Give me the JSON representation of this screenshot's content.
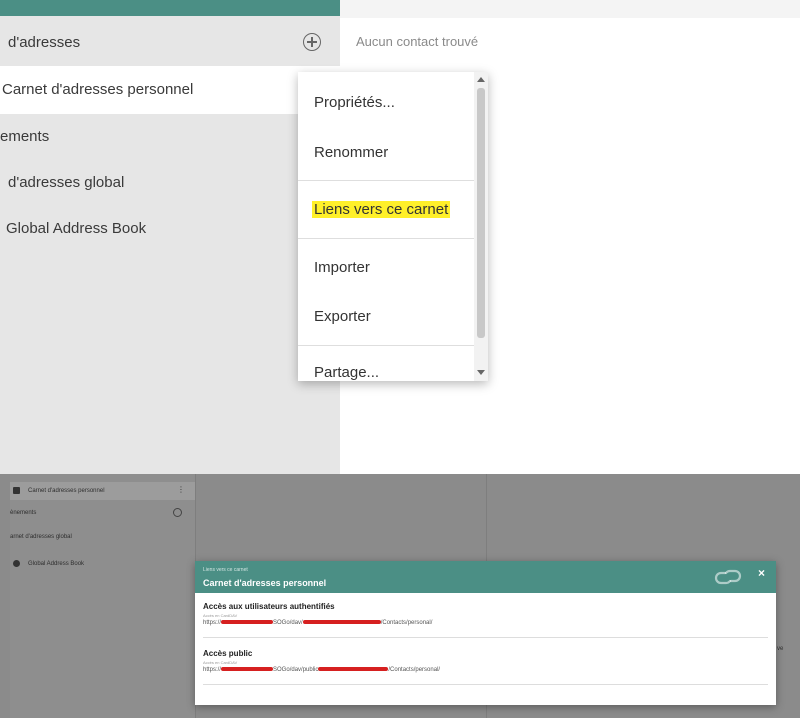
{
  "sidebar": {
    "header_label": "d'adresses",
    "items": [
      {
        "label": "Carnet d'adresses personnel"
      },
      {
        "label": "ements"
      },
      {
        "label": "d'adresses global"
      },
      {
        "label": "Global Address Book"
      }
    ]
  },
  "main": {
    "empty_message": "Aucun contact trouvé"
  },
  "context_menu": {
    "items": [
      {
        "label": "Propriétés..."
      },
      {
        "label": "Renommer"
      },
      {
        "label": "Liens vers ce carnet"
      },
      {
        "label": "Importer"
      },
      {
        "label": "Exporter"
      },
      {
        "label": "Partage..."
      }
    ],
    "highlight_color": "#fff02a"
  },
  "bottom_screenshot": {
    "sidebar_items": [
      {
        "label": "Carnet d'adresses personnel"
      },
      {
        "label": "ènements"
      },
      {
        "label": "arnet d'adresses global"
      },
      {
        "label": "Global Address Book"
      }
    ],
    "kebab_glyph": "⋮",
    "side_text": "ve",
    "dialog": {
      "subtitle": "Liens vers ce carnet",
      "title": "Carnet d'adresses personnel",
      "close_glyph": "×",
      "sections": [
        {
          "label": "Accès aux utilisateurs authentifiés",
          "sublabel": "Accès en CardDAV",
          "url_start": "https://",
          "url_mid": "SOGo/dav/",
          "url_end": "/Contacts/personal/"
        },
        {
          "label": "Accès public",
          "sublabel": "Accès en CardDAV",
          "url_start": "https://",
          "url_mid": "SOGo/dav/public",
          "url_end": "/Contacts/personal/"
        }
      ]
    }
  },
  "colors": {
    "accent": "#4b8f85",
    "sidebar_bg": "#e6e6e6",
    "redaction": "#d62020"
  }
}
